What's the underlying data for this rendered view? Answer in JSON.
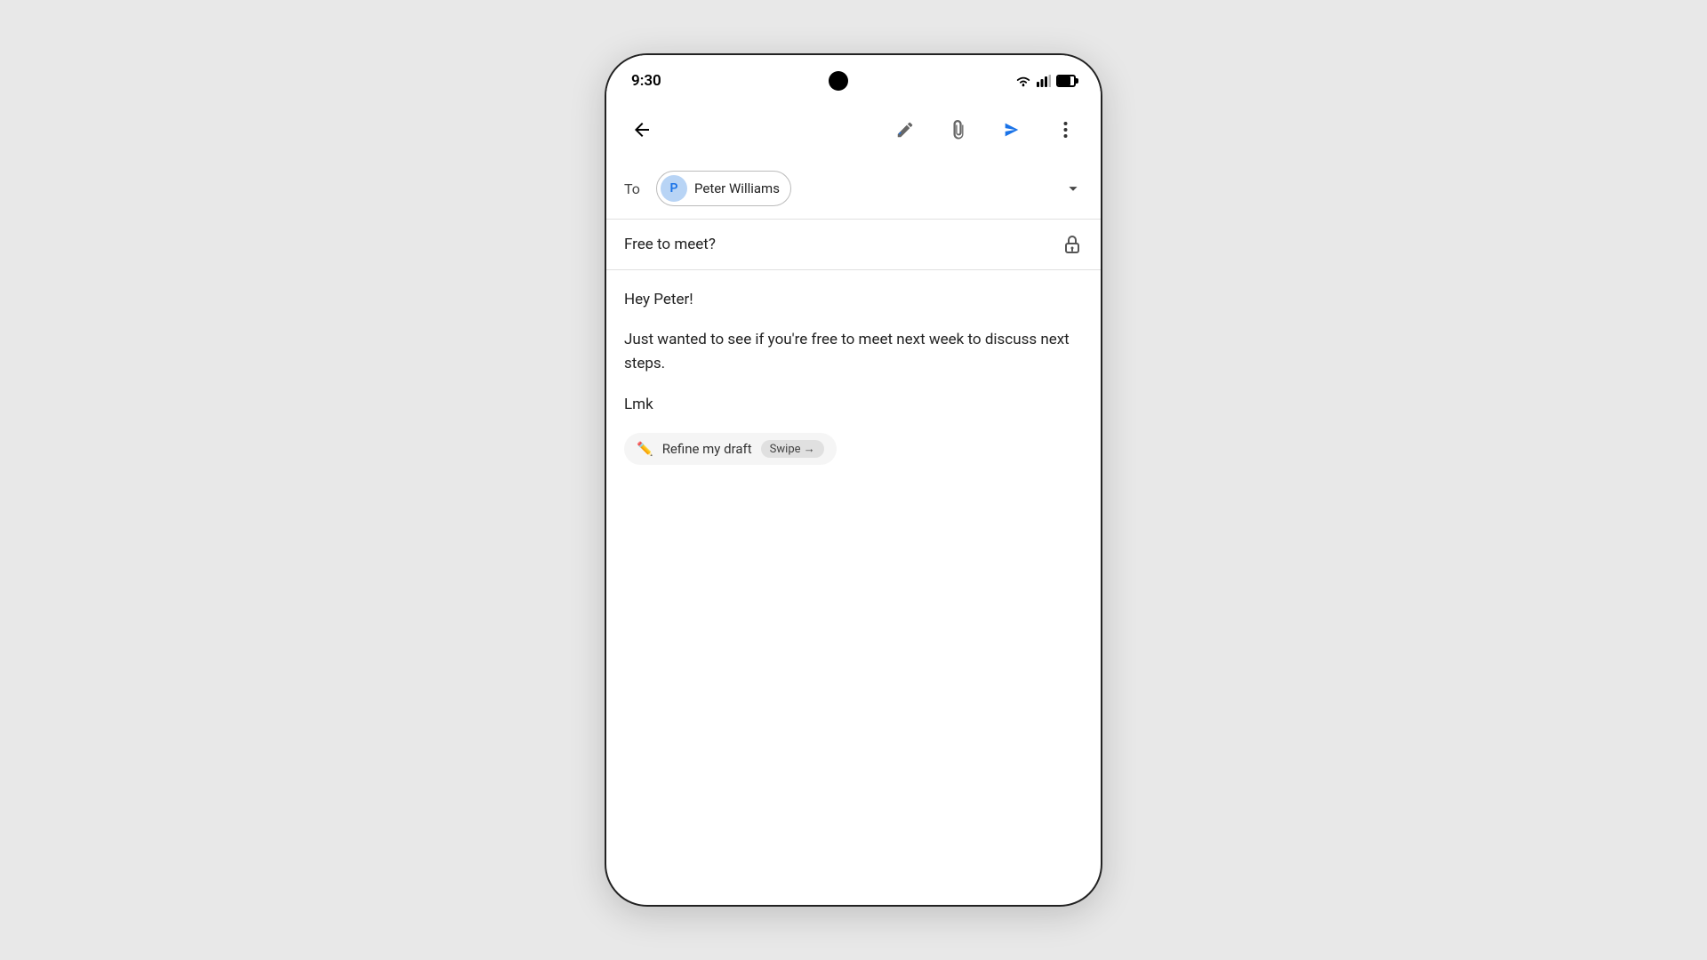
{
  "status_bar": {
    "time": "9:30",
    "center_label": "camera"
  },
  "toolbar": {
    "back_label": "←",
    "edit_label": "edit",
    "attach_label": "attach",
    "send_label": "send",
    "more_label": "more"
  },
  "to_field": {
    "label": "To",
    "recipient": {
      "initial": "P",
      "name": "Peter Williams"
    },
    "expand_label": "expand"
  },
  "subject": {
    "text": "Free to meet?",
    "lock_label": "lock"
  },
  "body": {
    "greeting": "Hey Peter!",
    "paragraph": "Just wanted to see if you're free to meet next week to discuss next steps.",
    "sign_off": "Lmk"
  },
  "refine_bar": {
    "icon": "✏️",
    "text": "Refine my draft",
    "swipe_text": "Swipe →"
  }
}
